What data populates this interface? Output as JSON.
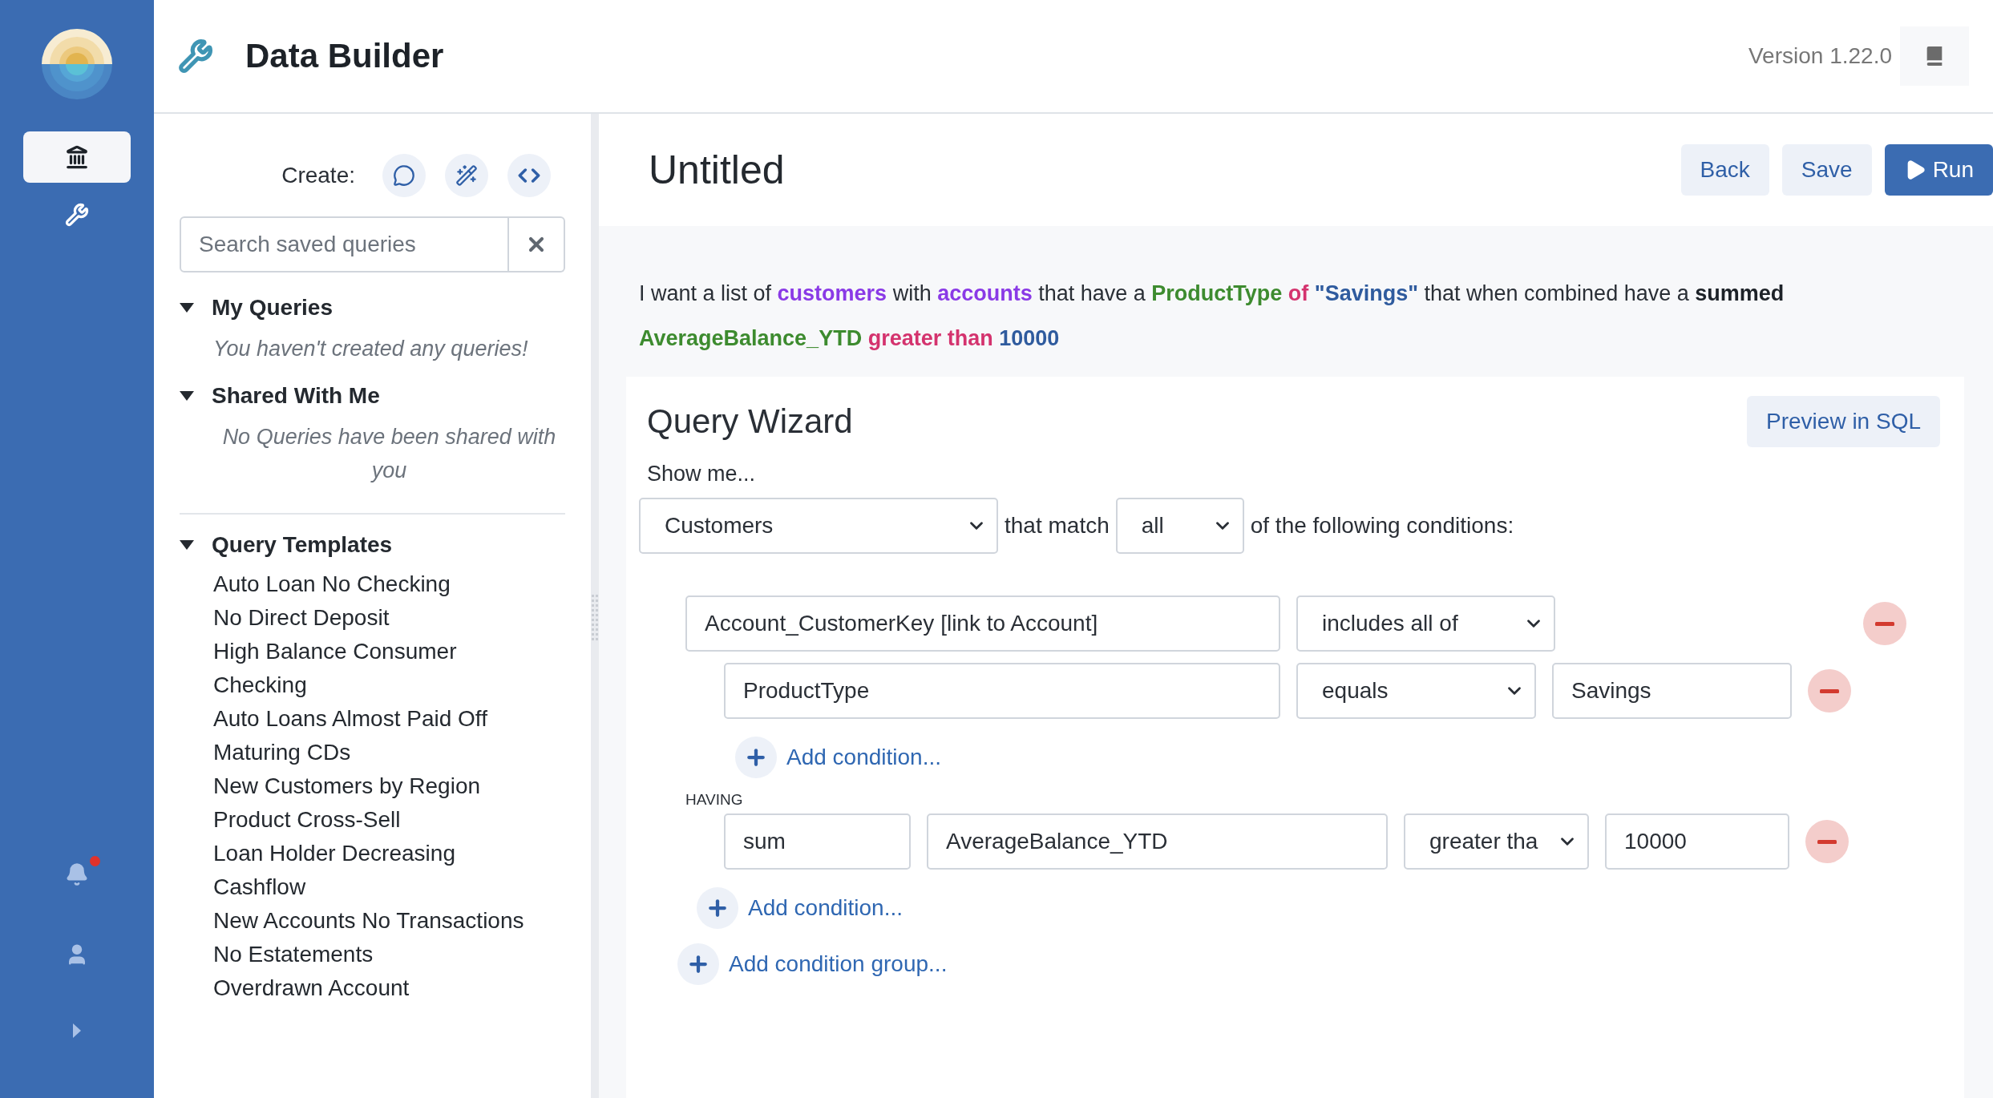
{
  "app": {
    "title": "Data Builder",
    "version": "Version 1.22.0"
  },
  "nav": {
    "items": [
      {
        "kind": "bank",
        "selected": true
      },
      {
        "kind": "wrench",
        "selected": false
      }
    ],
    "bottom": [
      {
        "kind": "bell",
        "notification": true
      },
      {
        "kind": "user",
        "notification": false
      },
      {
        "kind": "expand",
        "notification": false
      }
    ]
  },
  "sidebar": {
    "create_label": "Create:",
    "search": {
      "placeholder": "Search saved queries"
    },
    "sections": [
      {
        "title": "My Queries",
        "expanded": true,
        "empty_text": "You haven't created any queries!"
      },
      {
        "title": "Shared With Me",
        "expanded": true,
        "empty_text": "No Queries have been shared with you"
      }
    ],
    "templates": {
      "title": "Query Templates",
      "expanded": true,
      "items": [
        "Auto Loan No Checking",
        "No Direct Deposit",
        "High Balance Consumer Checking",
        "Auto Loans Almost Paid Off",
        "Maturing CDs",
        "New Customers by Region",
        "Product Cross-Sell",
        "Loan Holder Decreasing Cashflow",
        "New Accounts No Transactions",
        "No Estatements",
        "Overdrawn Account"
      ]
    }
  },
  "query": {
    "title": "Untitled",
    "buttons": [
      {
        "label": "Back",
        "kind": "secondary"
      },
      {
        "label": "Save",
        "kind": "secondary"
      },
      {
        "label": "Run",
        "kind": "primary"
      }
    ],
    "description": [
      {
        "text": "I want a list of ",
        "kind": "plain"
      },
      {
        "text": "customers",
        "kind": "entity"
      },
      {
        "text": " with ",
        "kind": "plain"
      },
      {
        "text": "accounts",
        "kind": "entity"
      },
      {
        "text": " that have a ",
        "kind": "plain"
      },
      {
        "text": "ProductType",
        "kind": "field"
      },
      {
        "text": " of ",
        "kind": "operator"
      },
      {
        "text": "\"Savings\"",
        "kind": "value"
      },
      {
        "text": " that when combined have a ",
        "kind": "plain"
      },
      {
        "text": "summed ",
        "kind": "bold"
      },
      {
        "text": "AverageBalance_YTD",
        "kind": "field"
      },
      {
        "text": " greater than ",
        "kind": "operator"
      },
      {
        "text": "10000",
        "kind": "value"
      }
    ]
  },
  "wizard": {
    "title": "Query Wizard",
    "preview_button": "Preview in SQL",
    "show_me": "Show me...",
    "entity": "Customers",
    "match_label": "that match",
    "match": "all",
    "conditions_label": "of the following conditions:",
    "group": {
      "field": "Account_CustomerKey [link to Account]",
      "operator": "includes all of",
      "conditions": [
        {
          "field": "ProductType",
          "operator": "equals",
          "value": "Savings"
        }
      ],
      "add_condition": "Add condition..."
    },
    "having": {
      "label": "HAVING",
      "rows": [
        {
          "aggregate": "sum",
          "field": "AverageBalance_YTD",
          "operator": "greater tha",
          "value": "10000"
        }
      ]
    },
    "add_condition": "Add condition...",
    "add_group": "Add condition group..."
  }
}
